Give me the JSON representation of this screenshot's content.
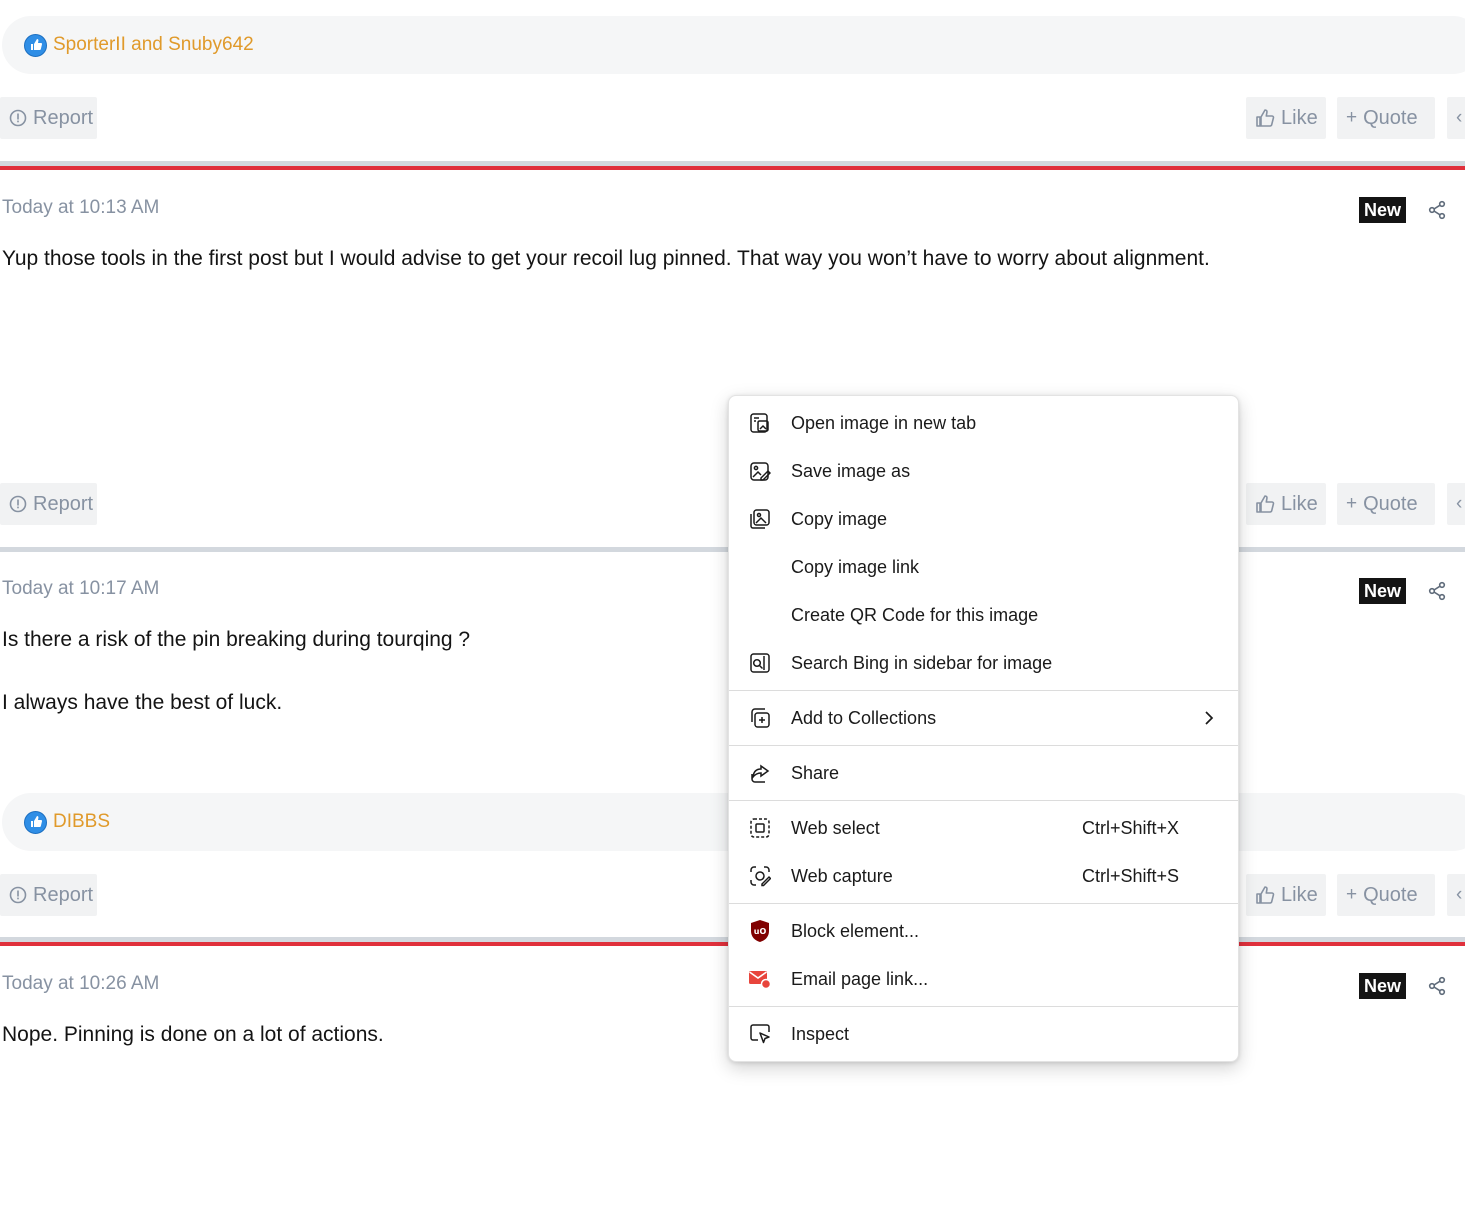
{
  "reactions": [
    {
      "text": "SporterII and Snuby642"
    },
    {
      "text": "DIBBS"
    }
  ],
  "actions": {
    "report": "Report",
    "like": "Like",
    "quote": "Quote"
  },
  "posts": [
    {
      "time": "Today at 10:13 AM",
      "badge": "New",
      "lines": [
        "Yup those tools in the first post but I would advise to get your recoil lug pinned. That way you won’t have to worry about alignment."
      ]
    },
    {
      "time": "Today at 10:17 AM",
      "badge": "New",
      "lines": [
        "Is there a risk of the pin breaking during tourqing ?",
        "I always have the best of luck."
      ]
    },
    {
      "time": "Today at 10:26 AM",
      "badge": "New",
      "lines": [
        "Nope. Pinning is done on a lot of actions."
      ]
    }
  ],
  "context_menu": {
    "items": [
      {
        "label": "Open image in new tab",
        "icon": "open-image-tab-icon"
      },
      {
        "label": "Save image as",
        "icon": "save-image-icon"
      },
      {
        "label": "Copy image",
        "icon": "copy-image-icon"
      },
      {
        "label": "Copy image link",
        "icon": ""
      },
      {
        "label": "Create QR Code for this image",
        "icon": ""
      },
      {
        "label": "Search Bing in sidebar for image",
        "icon": "bing-search-icon"
      },
      {
        "label": "Add to Collections",
        "icon": "collections-icon"
      },
      {
        "label": "Share",
        "icon": "share-icon"
      },
      {
        "label": "Web select",
        "icon": "web-select-icon",
        "shortcut": "Ctrl+Shift+X"
      },
      {
        "label": "Web capture",
        "icon": "web-capture-icon",
        "shortcut": "Ctrl+Shift+S"
      },
      {
        "label": "Block element...",
        "icon": "ublock-icon"
      },
      {
        "label": "Email page link...",
        "icon": "email-icon"
      },
      {
        "label": "Inspect",
        "icon": "inspect-icon"
      }
    ]
  },
  "colors": {
    "accent_red": "#e0303c",
    "reaction_text": "#e09a2b",
    "like_blue": "#2f8ee6",
    "muted": "#8792a2"
  }
}
